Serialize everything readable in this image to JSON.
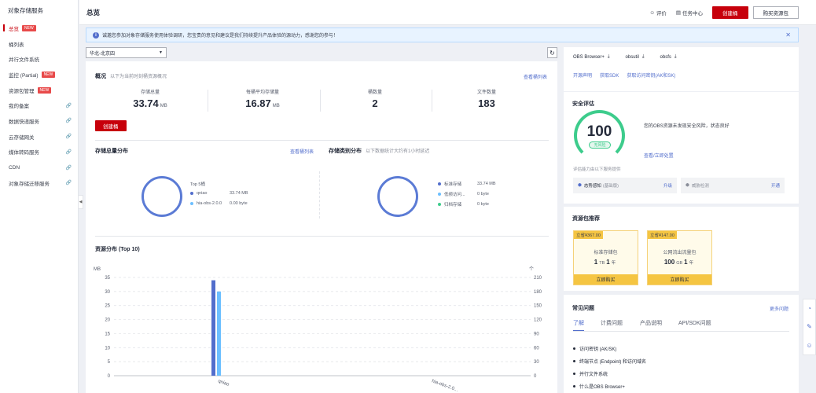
{
  "sidebar": {
    "title": "对象存储服务",
    "items": [
      {
        "label": "总览",
        "badge": "NEW",
        "active": true,
        "ext": false
      },
      {
        "label": "桶列表",
        "badge": "",
        "active": false,
        "ext": false
      },
      {
        "label": "并行文件系统",
        "badge": "",
        "active": false,
        "ext": false
      },
      {
        "label": "监控 (Partial)",
        "badge": "NEW",
        "active": false,
        "ext": false
      },
      {
        "label": "资源包管理",
        "badge": "NEW",
        "active": false,
        "ext": false
      },
      {
        "label": "我的备案",
        "badge": "",
        "active": false,
        "ext": true
      },
      {
        "label": "数据快递服务",
        "badge": "",
        "active": false,
        "ext": true
      },
      {
        "label": "云存储网关",
        "badge": "",
        "active": false,
        "ext": true
      },
      {
        "label": "媒体转码服务",
        "badge": "",
        "active": false,
        "ext": true
      },
      {
        "label": "CDN",
        "badge": "",
        "active": false,
        "ext": true
      },
      {
        "label": "对象存储迁移服务",
        "badge": "",
        "active": false,
        "ext": true
      }
    ]
  },
  "header": {
    "title": "总览",
    "rate": "评价",
    "task": "任务中心",
    "create_bucket": "创建桶",
    "buy_package": "购买资源包"
  },
  "notice": {
    "text": "诚邀您参加对象存储服务使用体验调研，您宝贵的意见和建议是我们持续提升产品体验的源动力，感谢您的参与！"
  },
  "region": {
    "value": "华北-北京四"
  },
  "overview": {
    "title": "概况",
    "subtitle": "以下为当前时刻桶资源概况",
    "view_buckets": "查看桶列表",
    "create_bucket": "创建桶",
    "stats": [
      {
        "label": "存储总量",
        "value": "33.74",
        "unit": "MB"
      },
      {
        "label": "每桶平均存储量",
        "value": "16.87",
        "unit": "MB"
      },
      {
        "label": "桶数量",
        "value": "2",
        "unit": ""
      },
      {
        "label": "文件数量",
        "value": "183",
        "unit": ""
      }
    ]
  },
  "storage_dist": {
    "title": "存储总量分布",
    "link": "查看桶列表",
    "legend_title": "Top 5桶",
    "rows": [
      {
        "name": "qniao",
        "value": "33.74  MB",
        "color": "#526ecc"
      },
      {
        "name": "hia-obs-2.0.0",
        "value": "0.00  byte",
        "color": "#6cbfff"
      }
    ]
  },
  "class_dist": {
    "title": "存储类别分布",
    "subtitle": "以下数据统计大约有1小时延迟",
    "rows": [
      {
        "name": "标准存储",
        "value": "33.74  MB",
        "color": "#526ecc"
      },
      {
        "name": "低频访问...",
        "value": "0  byte",
        "color": "#6cbfff"
      },
      {
        "name": "归档存储",
        "value": "0  byte",
        "color": "#3dcc8c"
      }
    ]
  },
  "resource": {
    "title": "资源分布 (Top 10)"
  },
  "chart_data": {
    "type": "bar",
    "categories": [
      "qniao",
      "hia-obs-2.0..."
    ],
    "series": [
      {
        "name": "",
        "values": [
          34,
          0
        ],
        "color": "#526ecc"
      },
      {
        "name": "",
        "values": [
          30,
          0
        ],
        "color": "#6cbfff"
      }
    ],
    "ylabel": "MB",
    "ylim": [
      0,
      35
    ],
    "y_ticks": [
      0,
      5,
      10,
      15,
      20,
      25,
      30,
      35
    ],
    "y2label": "个",
    "y2lim": [
      0,
      210
    ],
    "y2_ticks": [
      0,
      30,
      60,
      90,
      120,
      150,
      180,
      210
    ],
    "grid": true
  },
  "downloads": {
    "items": [
      "OBS Browser+",
      "obsutil",
      "obsfs"
    ],
    "links": [
      "开源声明",
      "获取SDK",
      "获取访问密钥(AK和SK)"
    ]
  },
  "security": {
    "title": "安全评估",
    "score": "100",
    "level": "无风险",
    "desc": "您的OBS资源未发现安全风险，状态良好",
    "view": "查看/立即处置",
    "recommend": "评估能力由以下服务提供",
    "services": [
      {
        "name": "态势感知",
        "note": "(基础版)",
        "action": "升级"
      },
      {
        "name": "威胁检测",
        "note": "",
        "action": "开通"
      }
    ]
  },
  "packages": {
    "title": "资源包推荐",
    "items": [
      {
        "tag": "立省¥367.00",
        "name": "标准存储包",
        "num": "1",
        "unit": "TB",
        "period": "1",
        "period_unit": "年",
        "buy": "立即购买"
      },
      {
        "tag": "立省¥147.00",
        "name": "公网流出流量包",
        "num": "100",
        "unit": "GB",
        "period": "1",
        "period_unit": "年",
        "buy": "立即购买"
      }
    ]
  },
  "faq": {
    "title": "常见问题",
    "more": "更多问题",
    "tabs": [
      "了解",
      "计费问题",
      "产品说明",
      "API/SDK问题"
    ],
    "items": [
      "访问密钥 (AK/SK)",
      "终端节点 (Endpoint) 和访问域名",
      "并行文件系统",
      "什么是OBS Browser+"
    ]
  }
}
